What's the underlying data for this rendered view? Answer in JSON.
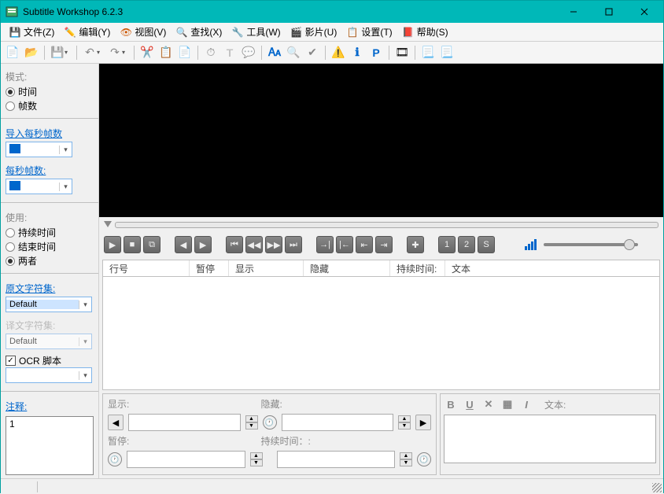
{
  "window": {
    "title": "Subtitle Workshop 6.2.3"
  },
  "menu": {
    "file": "文件(Z)",
    "edit": "编辑(Y)",
    "view": "视图(V)",
    "search": "查找(X)",
    "tools": "工具(W)",
    "movie": "影片(U)",
    "settings": "设置(T)",
    "help": "帮助(S)"
  },
  "sidebar": {
    "mode_label": "模式:",
    "mode_time": "时间",
    "mode_frames": "帧数",
    "input_fps_label": "导入每秒帧数",
    "fps_label": "每秒帧数:",
    "use_label": "使用:",
    "use_duration": "持续时间",
    "use_end": "结束时间",
    "use_both": "两者",
    "orig_charset_label": "原文字符集:",
    "orig_charset_value": "Default",
    "trans_charset_label": "译文字符集:",
    "trans_charset_value": "Default",
    "ocr_label": "OCR 脚本",
    "notes_label": "注释:",
    "notes_value": "1"
  },
  "list": {
    "col_num": "行号",
    "col_pause": "暂停",
    "col_show": "显示",
    "col_hide": "隐藏",
    "col_duration": "持续时间:",
    "col_text": "文本"
  },
  "timepanel": {
    "show_label": "显示:",
    "hide_label": "隐藏:",
    "pause_label": "暂停:",
    "duration_label": "持续时间：:"
  },
  "textpanel": {
    "text_label": "文本:"
  }
}
